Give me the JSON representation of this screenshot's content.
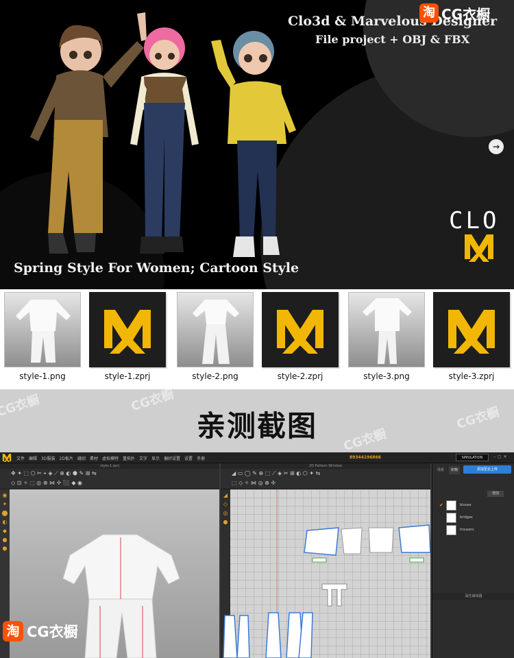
{
  "watermark": {
    "brand_icon": "淘",
    "brand_text": "CG衣橱"
  },
  "hero": {
    "title_line1": "Clo3d & Marvelous Designer",
    "title_line2": "File project + OBJ & FBX",
    "caption": "Spring Style For Women; Cartoon Style",
    "next_arrow": "→",
    "clo_logo": "CLO"
  },
  "thumbnails": [
    {
      "label": "style-1.png",
      "kind": "png"
    },
    {
      "label": "style-1.zprj",
      "kind": "zprj"
    },
    {
      "label": "style-2.png",
      "kind": "png"
    },
    {
      "label": "style-2.zprj",
      "kind": "zprj"
    },
    {
      "label": "style-3.png",
      "kind": "png"
    },
    {
      "label": "style-3.zprj",
      "kind": "zprj"
    }
  ],
  "band": {
    "heading": "亲测截图"
  },
  "app": {
    "menu": [
      "文件",
      "编辑",
      "3D服装",
      "2D板片",
      "缝纫",
      "素材",
      "虚拟模特",
      "重拓扑",
      "文字",
      "显示",
      "偏好设置",
      "设置",
      "手册"
    ],
    "account_id": "89344196866",
    "mode": "SIMULATION",
    "window_3d_title": "style-1.zprj",
    "window_2d_title": "2D Pattern Window",
    "right_panel": {
      "tabs": [
        "场景",
        "织物"
      ],
      "upload_button": "添加至云上传",
      "add_button": "增加",
      "fabrics": [
        {
          "label": "blouse",
          "checked": true
        },
        {
          "label": "bridges",
          "checked": false
        },
        {
          "label": "trousers",
          "checked": false
        }
      ],
      "property_title": "属性编辑器"
    }
  },
  "colors": {
    "accent_orange": "#ff5000",
    "md_yellow": "#f2b705",
    "upload_blue": "#2f7fd8"
  }
}
